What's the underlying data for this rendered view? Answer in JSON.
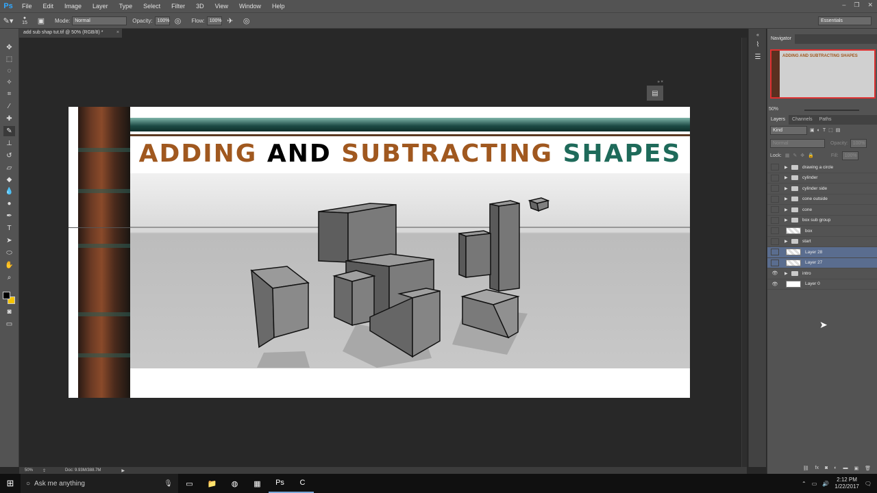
{
  "app": {
    "logo": "Ps"
  },
  "menu": [
    "File",
    "Edit",
    "Image",
    "Layer",
    "Type",
    "Select",
    "Filter",
    "3D",
    "View",
    "Window",
    "Help"
  ],
  "window_controls": [
    "–",
    "❐",
    "✕"
  ],
  "options": {
    "brush_size": "15",
    "mode_label": "Mode:",
    "mode_value": "Normal",
    "opacity_label": "Opacity:",
    "opacity_value": "100%",
    "flow_label": "Flow:",
    "flow_value": "100%",
    "workspace": "Essentials"
  },
  "document": {
    "tab_title": "add sub shap tut.tif @ 50% (RGB/8) *",
    "close_glyph": "×",
    "title_words": [
      "ADDING",
      "AND",
      "SUBTRACTING",
      "SHAPES"
    ]
  },
  "colors": {
    "foreground": "#000000",
    "background": "#f5c400",
    "title_brown": "#a0581f",
    "title_teal": "#1e6a5a",
    "selection": "#5a6d8f"
  },
  "navigator": {
    "tab": "Navigator",
    "zoom": "50%",
    "thumb_title": "ADDING AND SUBTRACTING SHAPES"
  },
  "layers_panel": {
    "tabs": [
      "Layers",
      "Channels",
      "Paths"
    ],
    "kind": "Kind",
    "blend_mode": "Normal",
    "opacity_label": "Opacity:",
    "opacity_value": "100%",
    "lock_label": "Lock:",
    "fill_label": "Fill:",
    "fill_value": "100%",
    "layers": [
      {
        "name": "drawing a circle",
        "type": "group",
        "visible": false,
        "selected": false
      },
      {
        "name": "cylinder",
        "type": "group",
        "visible": false,
        "selected": false
      },
      {
        "name": "cylinder side",
        "type": "group",
        "visible": false,
        "selected": false
      },
      {
        "name": "cone outside",
        "type": "group",
        "visible": false,
        "selected": false
      },
      {
        "name": "cone",
        "type": "group",
        "visible": false,
        "selected": false
      },
      {
        "name": "box sub group",
        "type": "group",
        "visible": false,
        "selected": false
      },
      {
        "name": "box",
        "type": "layer",
        "visible": false,
        "selected": false
      },
      {
        "name": "start",
        "type": "group",
        "visible": false,
        "selected": false
      },
      {
        "name": "Layer 28",
        "type": "layer",
        "visible": false,
        "selected": true
      },
      {
        "name": "Layer 27",
        "type": "layer",
        "visible": false,
        "selected": true
      },
      {
        "name": "intro",
        "type": "group",
        "visible": true,
        "selected": false
      },
      {
        "name": "Layer 0",
        "type": "layer",
        "visible": true,
        "selected": false
      }
    ],
    "footer_icons": [
      "link-icon",
      "fx-icon",
      "mask-icon",
      "adjustment-icon",
      "folder-icon",
      "new-layer-icon",
      "trash-icon"
    ]
  },
  "status": {
    "zoom": "50%",
    "doc_size": "Doc: 9.93M/388.7M"
  },
  "taskbar": {
    "search_placeholder": "Ask me anything",
    "time": "2:12 PM",
    "date": "1/22/2017"
  }
}
